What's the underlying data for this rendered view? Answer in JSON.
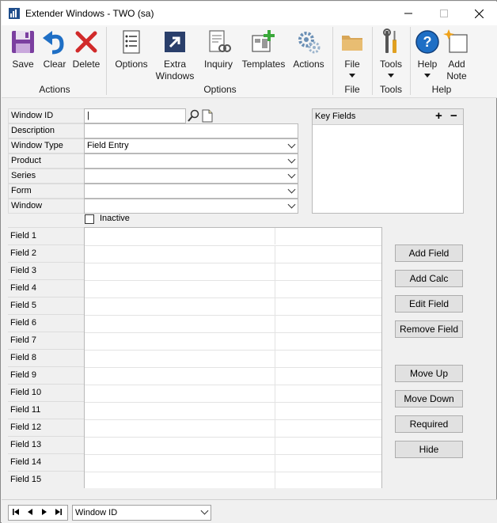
{
  "window": {
    "title": "Extender Windows  -  TWO (sa)"
  },
  "ribbon": {
    "save_label": "Save",
    "clear_label": "Clear",
    "delete_label": "Delete",
    "actions_group": "Actions",
    "options_label": "Options",
    "extra_windows_label_1": "Extra",
    "extra_windows_label_2": "Windows",
    "inquiry_label": "Inquiry",
    "templates_label": "Templates",
    "actions_label": "Actions",
    "options_group": "Options",
    "file_label": "File",
    "file_group": "File",
    "tools_label": "Tools",
    "tools_group": "Tools",
    "help_label": "Help",
    "add_note_label_1": "Add",
    "add_note_label_2": "Note",
    "help_group": "Help"
  },
  "form": {
    "window_id_label": "Window ID",
    "window_id_value": "|",
    "description_label": "Description",
    "description_value": "",
    "window_type_label": "Window Type",
    "window_type_value": "Field Entry",
    "product_label": "Product",
    "product_value": "",
    "series_label": "Series",
    "series_value": "",
    "form_label": "Form",
    "form_value": "",
    "window_label": "Window",
    "window_value": "",
    "inactive_label": "Inactive",
    "key_fields_label": "Key Fields",
    "key_fields_add": "+",
    "key_fields_remove": "−"
  },
  "fields": [
    {
      "label": "Field 1"
    },
    {
      "label": "Field 2"
    },
    {
      "label": "Field 3"
    },
    {
      "label": "Field 4"
    },
    {
      "label": "Field 5"
    },
    {
      "label": "Field 6"
    },
    {
      "label": "Field 7"
    },
    {
      "label": "Field 8"
    },
    {
      "label": "Field 9"
    },
    {
      "label": "Field 10"
    },
    {
      "label": "Field 11"
    },
    {
      "label": "Field 12"
    },
    {
      "label": "Field 13"
    },
    {
      "label": "Field 14"
    },
    {
      "label": "Field 15"
    }
  ],
  "buttons": {
    "add_field": "Add Field",
    "add_calc": "Add Calc",
    "edit_field": "Edit Field",
    "remove_field": "Remove Field",
    "move_up": "Move Up",
    "move_down": "Move Down",
    "required": "Required",
    "hide": "Hide"
  },
  "statusbar": {
    "sort_value": "Window ID"
  },
  "colors": {
    "accent_blue": "#1f6fc5",
    "delete_red": "#d12a2a",
    "templates_green": "#3aa83a",
    "folder_tan": "#d8a657"
  }
}
